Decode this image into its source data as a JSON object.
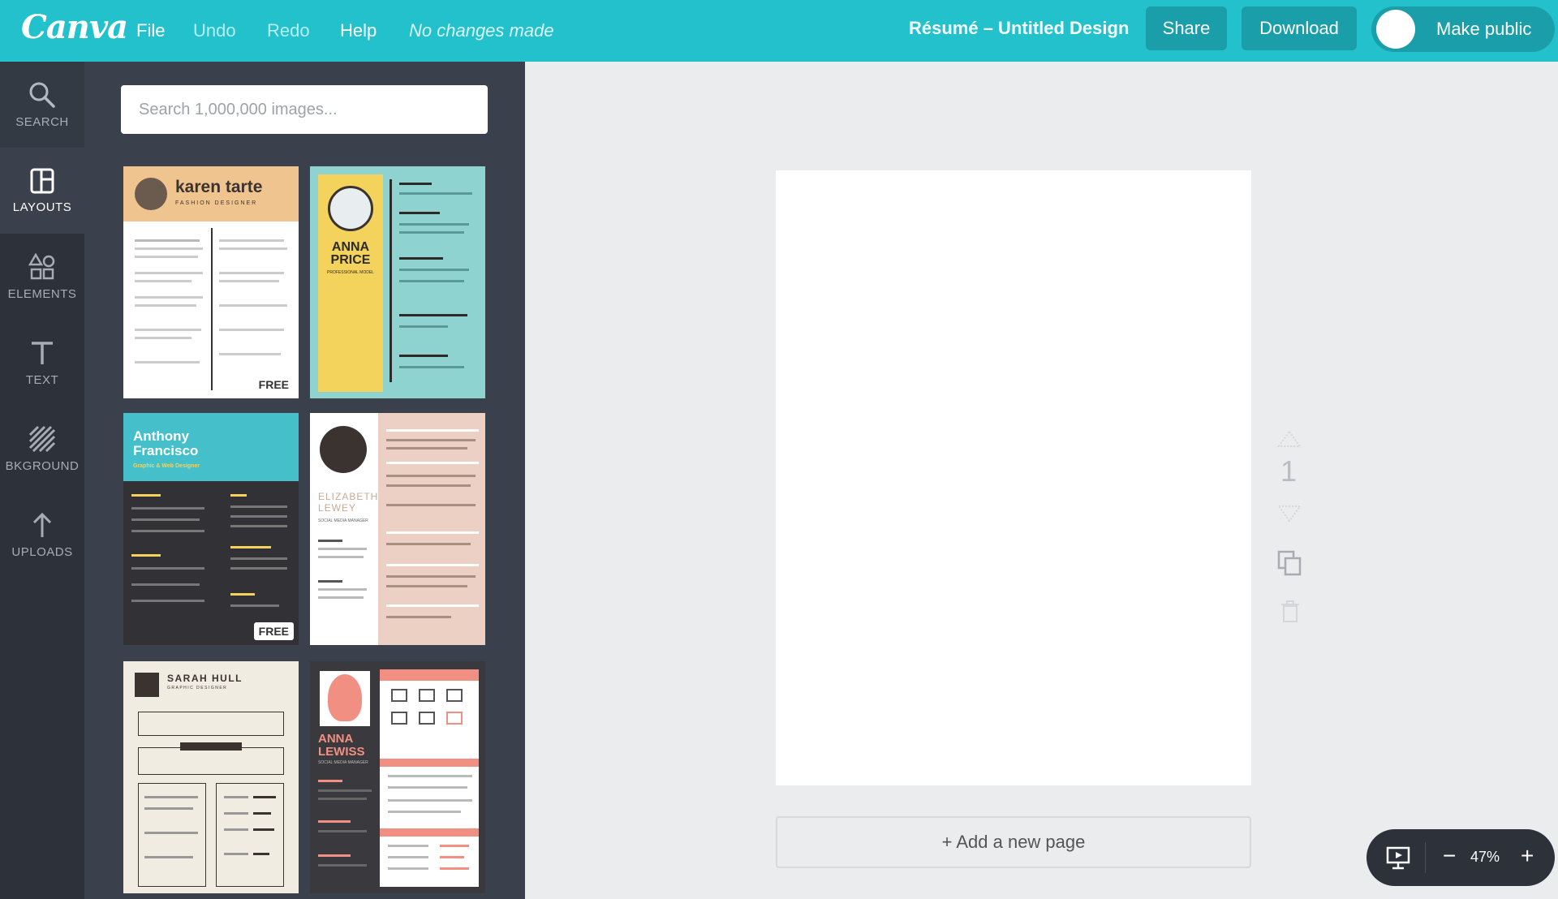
{
  "header": {
    "logo": "Canva",
    "menu": [
      "File",
      "Undo",
      "Redo",
      "Help"
    ],
    "status": "No changes made",
    "doc_title": "Résumé – Untitled Design",
    "share_label": "Share",
    "download_label": "Download",
    "public_label": "Make public"
  },
  "sidebar": {
    "items": [
      {
        "label": "SEARCH",
        "icon": "search-icon"
      },
      {
        "label": "LAYOUTS",
        "icon": "layouts-icon"
      },
      {
        "label": "ELEMENTS",
        "icon": "elements-icon"
      },
      {
        "label": "TEXT",
        "icon": "text-icon"
      },
      {
        "label": "BKGROUND",
        "icon": "background-icon"
      },
      {
        "label": "UPLOADS",
        "icon": "upload-icon"
      }
    ],
    "active": "LAYOUTS"
  },
  "panel": {
    "search_placeholder": "Search 1,000,000 images...",
    "templates": [
      {
        "name": "karen tarte",
        "role": "FASHION DESIGNER",
        "badge": "FREE",
        "colors": {
          "header": "#f0c48f",
          "body": "#ffffff"
        }
      },
      {
        "name": "ANNA PRICE",
        "role": "PROFESSIONAL MODEL",
        "badge": "",
        "colors": {
          "header": "#f3d35b",
          "body": "#8fd3d0"
        }
      },
      {
        "name": "Anthony Francisco",
        "role": "Graphic & Web Designer",
        "badge": "FREE",
        "colors": {
          "header": "#45bfc9",
          "body": "#323236"
        }
      },
      {
        "name": "ELIZABETH LEWEY",
        "role": "SOCIAL MEDIA MANAGER",
        "badge": "",
        "colors": {
          "header": "#ffffff",
          "body": "#ecd0c4"
        }
      },
      {
        "name": "SARAH HULL",
        "role": "GRAPHIC DESIGNER",
        "badge": "",
        "colors": {
          "header": "#f1ece2",
          "body": "#f1ece2"
        }
      },
      {
        "name": "ANNA LEWISS",
        "role": "SOCIAL MEDIA MANAGER",
        "badge": "",
        "colors": {
          "header": "#3a3a3e",
          "body": "#f08f82"
        }
      }
    ]
  },
  "canvas": {
    "page_number": "1",
    "add_page_label": "+ Add a new page"
  },
  "zoom": {
    "value": "47%",
    "minus": "−",
    "plus": "+"
  }
}
